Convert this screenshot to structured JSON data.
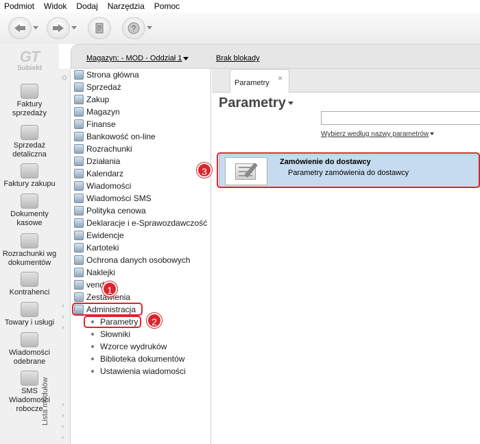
{
  "menu": [
    "Podmiot",
    "Widok",
    "Dodaj",
    "Narzędzia",
    "Pomoc"
  ],
  "logo": {
    "mark": "GT",
    "name": "Subiekt"
  },
  "appbar": [
    {
      "label": "Faktury\nsprzedaży",
      "icon": "invoice-icon"
    },
    {
      "label": "Sprzedaż\ndetaliczna",
      "icon": "retail-icon"
    },
    {
      "label": "Faktury zakupu",
      "icon": "purchase-icon"
    },
    {
      "label": "Dokumenty\nkasowe",
      "icon": "cash-icon"
    },
    {
      "label": "Rozrachunki wg\ndokumentów",
      "icon": "settlement-icon"
    },
    {
      "label": "Kontrahenci",
      "icon": "contractor-icon"
    },
    {
      "label": "Towary i usługi",
      "icon": "goods-icon"
    },
    {
      "label": "Wiadomości\nodebrane",
      "icon": "inbox-icon"
    },
    {
      "label": "SMS\nWiadomości\nrobocze",
      "icon": "sms-icon"
    }
  ],
  "framebar": {
    "magazyn": "Magazyn: - MOD - Oddział 1",
    "blokady": "Brak blokady"
  },
  "modules_label": "Lista modułów",
  "nav": [
    "Strona główna",
    "Sprzedaż",
    "Zakup",
    "Magazyn",
    "Finanse",
    "Bankowość on-line",
    "Rozrachunki",
    "Działania",
    "Kalendarz",
    "Wiadomości",
    "Wiadomości SMS",
    "Polityka cenowa",
    "Deklaracje i e-Sprawozdawczość",
    "Ewidencje",
    "Kartoteki",
    "Ochrona danych osobowych",
    "Naklejki",
    "vendo",
    "Zestawienia",
    "Administracja"
  ],
  "subnav": [
    "Parametry",
    "Słowniki",
    "Wzorce wydruków",
    "Biblioteka dokumentów",
    "Ustawienia wiadomości"
  ],
  "main": {
    "tab": "Parametry",
    "close": "×",
    "title": "Parametry",
    "search_value": "",
    "filter": "Wybierz według nazwy parametrów",
    "row": {
      "title": "Zamówienie do dostawcy",
      "desc": "Parametry zamówienia do dostawcy"
    }
  },
  "badges": [
    "1",
    "2",
    "3"
  ],
  "colors": {
    "highlight": "#d9262c",
    "selected_row": "#c6dbef"
  }
}
